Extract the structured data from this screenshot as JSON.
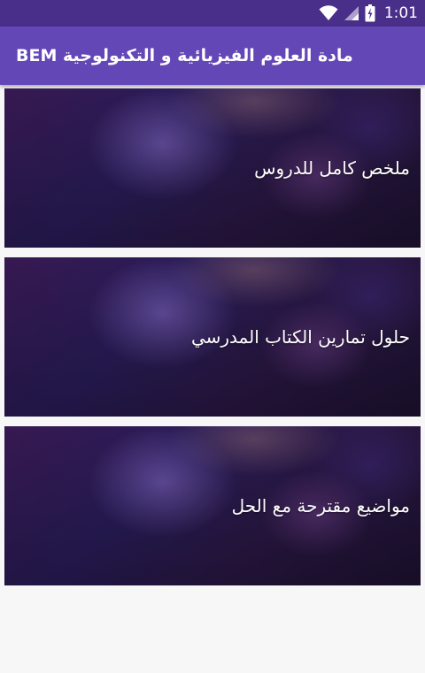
{
  "status_bar": {
    "time": "1:01",
    "icons": [
      "wifi-icon",
      "signal-icon",
      "battery-icon"
    ]
  },
  "app_bar": {
    "title": "مادة العلوم الفيزيائية و التكنولوجية BEM"
  },
  "cards": [
    {
      "label": "ملخص كامل للدروس"
    },
    {
      "label": "حلول تمارين الكتاب المدرسي"
    },
    {
      "label": "مواضيع مقترحة مع الحل"
    }
  ],
  "colors": {
    "status_bar": "#4a2f8a",
    "app_bar": "#6447b6",
    "background": "#f7f7f7",
    "card_text": "#ffffff"
  }
}
